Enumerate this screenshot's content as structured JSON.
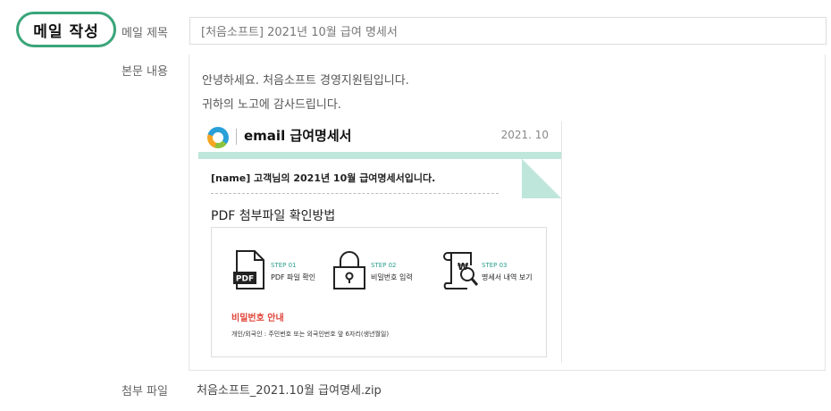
{
  "badge": "메일 작성",
  "labels": {
    "subject": "메일 제목",
    "body": "본문 내용",
    "attachment": "첨부 파일"
  },
  "subject_value": "[처음소프트] 2021년 10월 급여 명세서",
  "body_lines": [
    "안녕하세요. 처음소프트 경영지원팀입니다.",
    "귀하의 노고에 감사드립니다."
  ],
  "email": {
    "title": "email 급여명세서",
    "date": "2021. 10",
    "greeting": "[name] 고객님의 2021년 10월 급여명세서입니다.",
    "section_title": "PDF 첨부파일 확인방법",
    "steps": [
      {
        "num": "STEP 01",
        "label": "PDF 파일 확인",
        "icon": "pdf-file-icon"
      },
      {
        "num": "STEP 02",
        "label": "비밀번호 입력",
        "icon": "padlock-icon"
      },
      {
        "num": "STEP 03",
        "label": "명세서 내역 보기",
        "icon": "receipt-magnifier-icon"
      }
    ],
    "pdf_icon_text": "PDF",
    "won_symbol": "₩",
    "password_title": "비밀번호 안내",
    "password_desc": "개인/외국인 : 주민번호 또는 외국인번호 앞 6자리(생년월일)"
  },
  "attachment_name": "처음소프트_2021.10월 급여명세.zip",
  "colors": {
    "accent_green": "#3aa57a",
    "band_mint": "#bfe6da",
    "step_teal": "#2a9d8f",
    "warning_red": "#e0453a"
  }
}
